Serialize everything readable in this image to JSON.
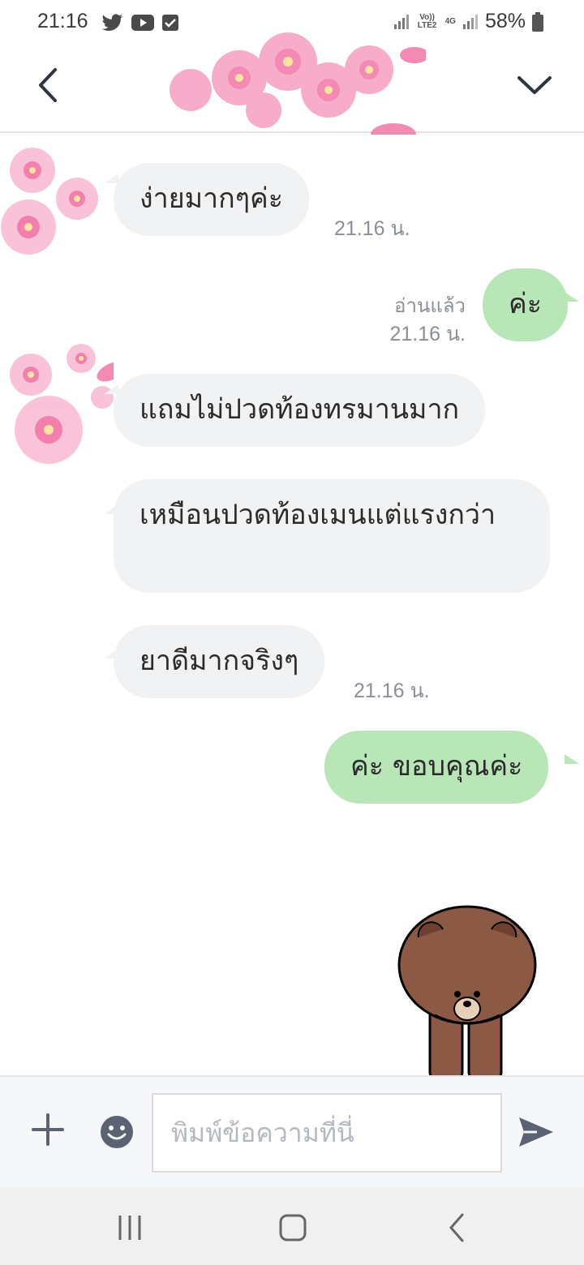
{
  "status_bar": {
    "time": "21:16",
    "network_label_top": "Vo)) LTE2",
    "network_label_4g": "4G",
    "battery": "58%"
  },
  "chat": {
    "messages": [
      {
        "side": "in",
        "text": "ง่ายมากๆค่ะ",
        "time": "21.16 น."
      },
      {
        "side": "out",
        "text": "ค่ะ",
        "read": "อ่านแล้ว",
        "time": "21.16 น."
      },
      {
        "side": "in",
        "text": "แถมไม่ปวดท้องทรมานมาก"
      },
      {
        "side": "in",
        "text": "เหมือนปวดท้องเมนแต่แรงกว่า"
      },
      {
        "side": "in",
        "text": "ยาดีมากจริงๆ",
        "time": "21.16 น."
      },
      {
        "side": "out",
        "text": "ค่ะ ขอบคุณค่ะ"
      }
    ]
  },
  "input": {
    "placeholder": "พิมพ์ข้อความที่นี่",
    "value": ""
  },
  "colors": {
    "incoming_bubble": "#f1f2f4",
    "outgoing_bubble": "#b8e6b6",
    "icon": "#5a6273",
    "timestamp": "#8a8f98"
  },
  "icons": {
    "back": "chevron-left-icon",
    "menu": "chevron-down-icon",
    "plus": "plus-icon",
    "emoji": "emoji-icon",
    "send": "send-icon",
    "sticker": "brown-bear-sticker"
  }
}
